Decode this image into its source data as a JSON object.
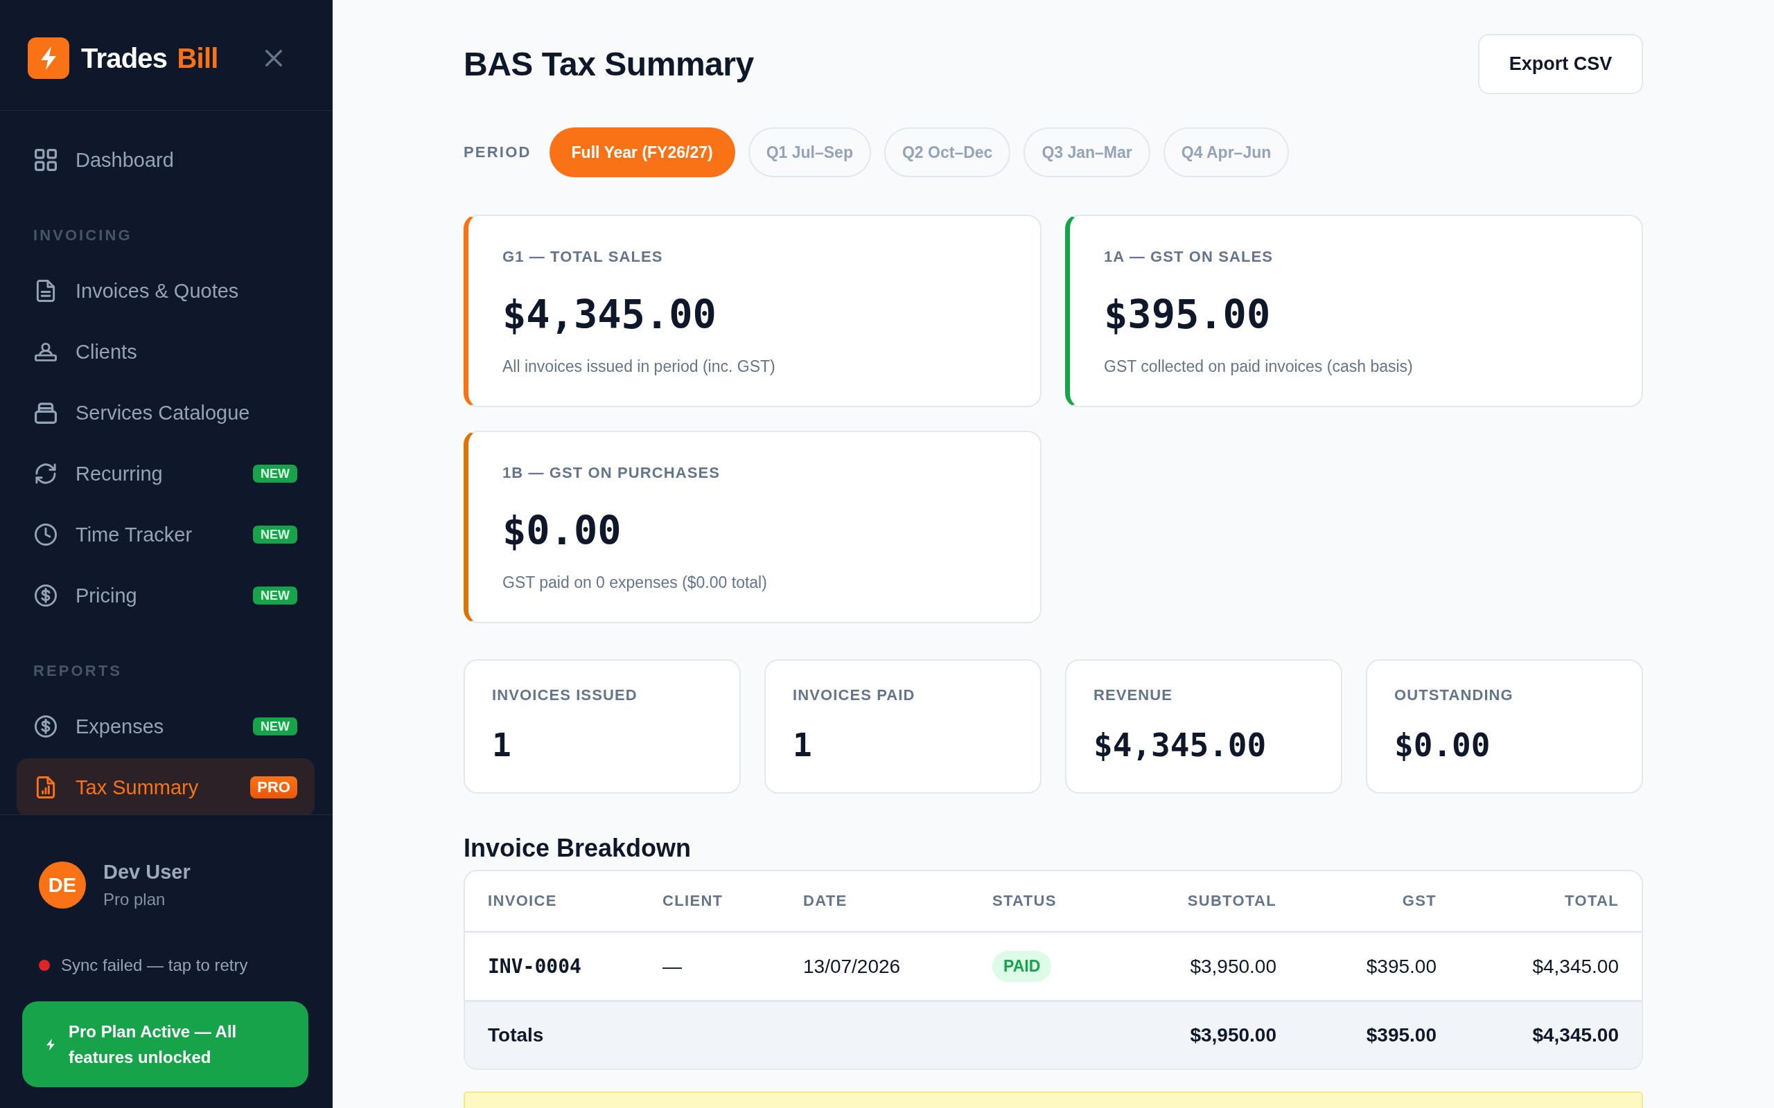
{
  "sidebar": {
    "brand": {
      "name": "Trades",
      "accent": "Bill"
    },
    "nav": [
      {
        "items": [
          {
            "label": "Dashboard",
            "selected": false
          }
        ]
      },
      {
        "heading": "INVOICING",
        "items": [
          {
            "label": "Invoices & Quotes",
            "selected": false
          },
          {
            "label": "Clients",
            "selected": false
          },
          {
            "label": "Services Catalogue",
            "selected": false
          },
          {
            "label": "Recurring",
            "selected": false,
            "badge": {
              "text": "NEW",
              "kind": "new"
            }
          },
          {
            "label": "Time Tracker",
            "selected": false,
            "badge": {
              "text": "NEW",
              "kind": "new"
            }
          },
          {
            "label": "Pricing",
            "selected": false,
            "badge": {
              "text": "NEW",
              "kind": "new"
            }
          }
        ]
      },
      {
        "heading": "REPORTS",
        "items": [
          {
            "label": "Expenses",
            "selected": false,
            "badge": {
              "text": "NEW",
              "kind": "new"
            }
          },
          {
            "label": "Tax Summary",
            "selected": true,
            "badge": {
              "text": "PRO",
              "kind": "pro"
            }
          }
        ]
      }
    ],
    "user": {
      "initials": "DE",
      "name": "Dev User",
      "plan": "Pro plan"
    },
    "sync": {
      "text": "Sync failed — tap to retry",
      "failed": true
    },
    "plan_banner": "Pro Plan Active — All features unlocked"
  },
  "page": {
    "title": "BAS Tax Summary",
    "export_button": "Export CSV"
  },
  "period": {
    "label": "PERIOD",
    "options": [
      {
        "label": "Full Year (FY26/27)",
        "selected": true
      },
      {
        "label": "Q1 Jul–Sep",
        "selected": false
      },
      {
        "label": "Q2 Oct–Dec",
        "selected": false
      },
      {
        "label": "Q3 Jan–Mar",
        "selected": false
      },
      {
        "label": "Q4 Apr–Jun",
        "selected": false
      }
    ]
  },
  "bas_cards": [
    {
      "label": "G1 — TOTAL SALES",
      "value": "$4,345.00",
      "note": "All invoices issued in period (inc. GST)",
      "color": "#f97316"
    },
    {
      "label": "1A — GST ON SALES",
      "value": "$395.00",
      "note": "GST collected on paid invoices (cash basis)",
      "color": "#16a34a"
    },
    {
      "label": "1B — GST ON PURCHASES",
      "value": "$0.00",
      "note": "GST paid on 0 expenses ($0.00 total)",
      "color": "#d97706"
    }
  ],
  "stats": [
    {
      "label": "INVOICES ISSUED",
      "value": "1"
    },
    {
      "label": "INVOICES PAID",
      "value": "1"
    },
    {
      "label": "REVENUE",
      "value": "$4,345.00"
    },
    {
      "label": "OUTSTANDING",
      "value": "$0.00"
    }
  ],
  "breakdown": {
    "title": "Invoice Breakdown",
    "columns": [
      "INVOICE",
      "CLIENT",
      "DATE",
      "STATUS",
      "SUBTOTAL",
      "GST",
      "TOTAL"
    ],
    "rows": [
      {
        "invoice": "INV-0004",
        "client": "—",
        "date": "13/07/2026",
        "status": {
          "text": "PAID",
          "kind": "paid"
        },
        "subtotal": "$3,950.00",
        "gst": "$395.00",
        "total": "$4,345.00"
      }
    ],
    "totals": {
      "label": "Totals",
      "subtotal": "$3,950.00",
      "gst": "$395.00",
      "total": "$4,345.00"
    }
  }
}
